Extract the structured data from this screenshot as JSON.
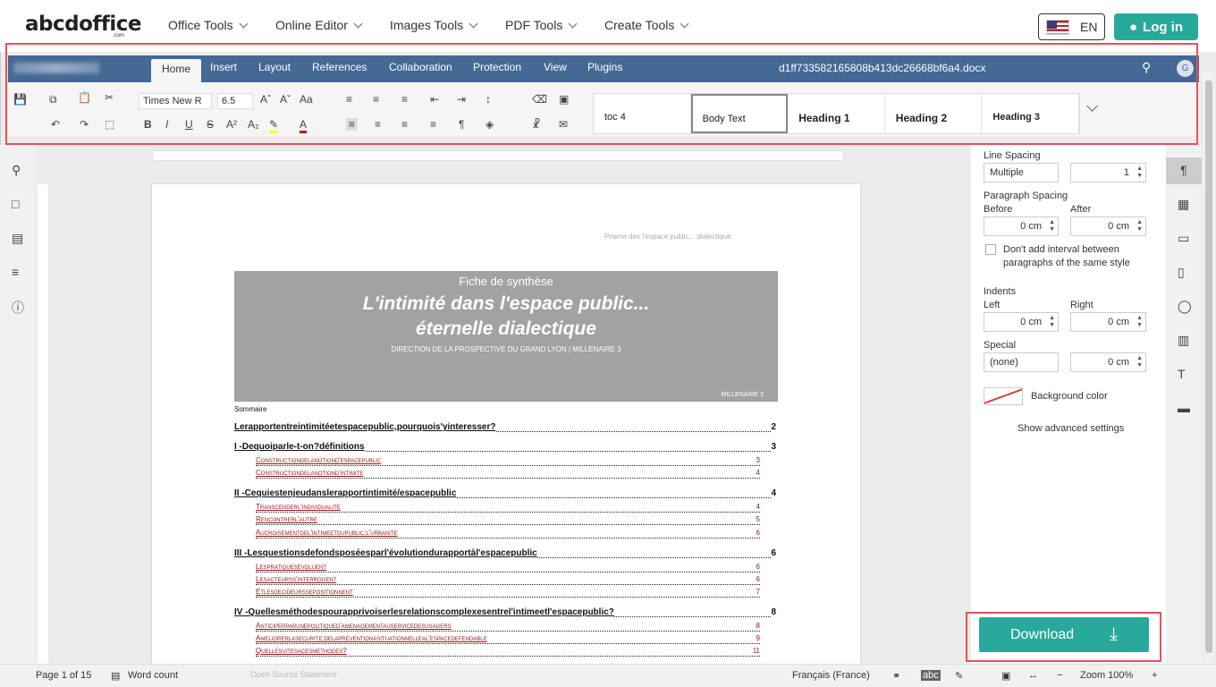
{
  "site": {
    "logo": "abcdoffice",
    "logo_sub": ".com",
    "nav": [
      "Office Tools",
      "Online Editor",
      "Images Tools",
      "PDF Tools",
      "Create Tools"
    ],
    "language": "EN",
    "login": "Log in"
  },
  "editor": {
    "tabs": [
      "Home",
      "Insert",
      "Layout",
      "References",
      "Collaboration",
      "Protection",
      "View",
      "Plugins"
    ],
    "filename": "d1ff733582165808b413dc26668bf6a4.docx",
    "user_initial": "G",
    "font_name": "Times New R",
    "font_size": "6.5",
    "styles": [
      "toc 4",
      "Body Text",
      "Heading 1",
      "Heading 2",
      "Heading 3"
    ]
  },
  "document": {
    "header_text": "Prisme des l'espace public... dialectique",
    "banner_title": "Fiche de synthèse",
    "banner_main1": "L'intimité dans l'espace public...",
    "banner_main2": "éternelle dialectique",
    "banner_sub": "DIRECTION DE LA PROSPECTIVE DU GRAND LYON | MILLENAIRE 3",
    "banner_brand": "MILLENAIRE 3",
    "sommaire": "Sommaire",
    "toc": [
      {
        "text": "Lerapportentreintimitéetespacepublic,pourquois'yinteresser?",
        "page": "2",
        "level": 0
      },
      {
        "text": "I   -Dequoiparle-t-on?définitions",
        "page": "3",
        "level": 1
      },
      {
        "text": "Constructiondelanotiond'espacepublic",
        "page": "3",
        "level": 2
      },
      {
        "text": "Constructiondelanotiond'intimite",
        "page": "4",
        "level": 2
      },
      {
        "text": "II   -Cequiestenjeudanslerapportintimité/espacepublic",
        "page": "4",
        "level": 1
      },
      {
        "text": "Transcenderl'individualite",
        "page": "4",
        "level": 2
      },
      {
        "text": "Rencontrerl'autre",
        "page": "5",
        "level": 2
      },
      {
        "text": "Aucroisementdel'intimeetdupublic:l'urbanite",
        "page": "6",
        "level": 2
      },
      {
        "text": "III    -Lesquestionsdefondsposéesparl'évolutiondurapportàl'espacepublic",
        "page": "6",
        "level": 1
      },
      {
        "text": "Lespratiquesevoluent",
        "page": "6",
        "level": 2
      },
      {
        "text": "Lesacteurss'interrogent",
        "page": "6",
        "level": 2
      },
      {
        "text": "Etlesdecideurssepositionnent",
        "page": "7",
        "level": 2
      },
      {
        "text": "IV   -Quellesméthodespourapprivoiserlesrelationscomplexesentrel'intimeetl'espacepublic?",
        "page": "8",
        "level": 1
      },
      {
        "text": "Anticiperparunepolitiqued'amenagementauservicedesusagers",
        "page": "8",
        "level": 2
      },
      {
        "text": "Ameliorerlasecurite:delapreventionasituationnelleal'espacedefendable",
        "page": "9",
        "level": 2
      },
      {
        "text": "Quellesuitesacesmethodes?",
        "page": "11",
        "level": 2
      }
    ]
  },
  "panel": {
    "line_spacing": "Line Spacing",
    "line_mode": "Multiple",
    "line_value": "1",
    "paragraph_spacing": "Paragraph Spacing",
    "before": "Before",
    "after": "After",
    "before_value": "0 cm",
    "after_value": "0 cm",
    "dont_add": "Don't add interval between",
    "dont_add2": "paragraphs of the same style",
    "indents": "Indents",
    "left": "Left",
    "right": "Right",
    "left_value": "0 cm",
    "right_value": "0 cm",
    "special": "Special",
    "special_mode": "(none)",
    "special_value": "0 cm",
    "bg_color": "Background color",
    "advanced": "Show advanced settings"
  },
  "status": {
    "page": "Page 1 of 15",
    "word_count": "Word count",
    "language": "Français (France)",
    "zoom": "Zoom 100%",
    "center": "Open Source Statement"
  },
  "download": "Download"
}
